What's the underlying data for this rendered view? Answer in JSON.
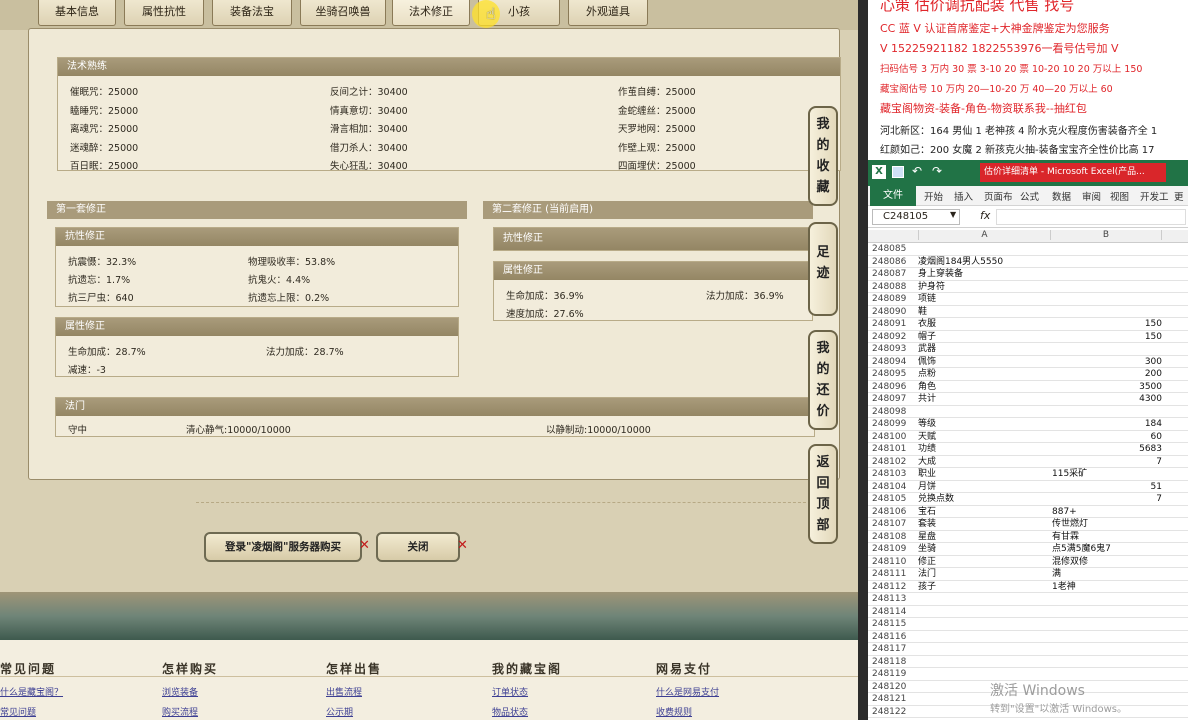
{
  "game": {
    "tabs": [
      "基本信息",
      "属性抗性",
      "装备法宝",
      "坐骑召唤兽",
      "法术修正",
      "小孩",
      "外观道具"
    ],
    "skill_section": {
      "title": "法术熟练",
      "rows": [
        [
          "催眠咒：25000",
          "反间之计：30400",
          "作茧自缚：25000"
        ],
        [
          "瞌睡咒：25000",
          "情真意切：30400",
          "金蛇缠丝：25000"
        ],
        [
          "离魂咒：25000",
          "滑言相加：30400",
          "天罗地网：25000"
        ],
        [
          "迷魂醉：25000",
          "借刀杀人：30400",
          "作壁上观：25000"
        ],
        [
          "百日眠：25000",
          "失心狂乱：30400",
          "四面埋伏：25000"
        ]
      ]
    },
    "set1": {
      "title": "第一套修正",
      "resist": {
        "title": "抗性修正",
        "items": [
          "抗震慑：32.3%",
          "物理吸收率：53.8%",
          "抗遗忘：1.7%",
          "抗鬼火：4.4%",
          "抗三尸虫：640",
          "抗遗忘上限：0.2%"
        ]
      },
      "attr": {
        "title": "属性修正",
        "items": [
          "生命加成：28.7%",
          "法力加成：28.7%",
          "减速：-3"
        ]
      }
    },
    "set2": {
      "title": "第二套修正 (当前启用)",
      "resist": {
        "title": "抗性修正"
      },
      "attr": {
        "title": "属性修正",
        "items": [
          "生命加成：36.9%",
          "法力加成：36.9%",
          "速度加成：27.6%"
        ]
      }
    },
    "magic": {
      "title": "法门",
      "items": [
        "守中",
        "清心静气:10000/10000",
        "以静制动:10000/10000"
      ]
    },
    "buttons": {
      "buy": "登录\"凌烟阁\"服务器购买",
      "close": "关闭"
    },
    "side": [
      "我的收藏",
      "足迹",
      "我的还价",
      "返回顶部"
    ],
    "footer": {
      "cols": [
        {
          "title": "常见问题",
          "links": [
            "什么是藏宝阁？",
            "常见问题"
          ]
        },
        {
          "title": "怎样购买",
          "links": [
            "浏览装备",
            "购买流程"
          ]
        },
        {
          "title": "怎样出售",
          "links": [
            "出售流程",
            "公示期"
          ]
        },
        {
          "title": "我的藏宝阁",
          "links": [
            "订单状态",
            "物品状态"
          ]
        },
        {
          "title": "网易支付",
          "links": [
            "什么是网易支付",
            "收费规则"
          ]
        }
      ]
    }
  },
  "notes": {
    "lines": [
      "心策 估价调抗配装 代售 找号",
      "CC 蓝 V 认证首席鉴定+大神金牌鉴定为您服务",
      "V 15225921182      1822553976一看号估号加 V",
      "扫码估号 3 万内 30 票 3-10 20 票 10-20 10 20 万以上 150",
      "藏宝阁估号 10 万内 20—10-20 万 40—20 万以上 60",
      "藏宝阁物资-装备-角色-物资联系我--抽红包",
      "河北新区：164 男仙 1 老神孩 4 阶水克火程度伤害装备齐全 1",
      "红颜如己：200 女魔 2 新孩克火抽-装备宝宝齐全性价比高 17"
    ]
  },
  "excel": {
    "title": "估价详细清单 - Microsoft Excel(产品...",
    "ribbon": [
      "文件",
      "开始",
      "插入",
      "页面布",
      "公式",
      "数据",
      "审阅",
      "视图",
      "开发工",
      "更"
    ],
    "namebox": "C248105",
    "fx": "fx",
    "cols": [
      "A",
      "B"
    ],
    "rows": [
      [
        "248085",
        "",
        ""
      ],
      [
        "248086",
        "凌烟阁184男人5550",
        ""
      ],
      [
        "248087",
        "身上穿装备",
        ""
      ],
      [
        "248088",
        "护身符",
        ""
      ],
      [
        "248089",
        "项链",
        ""
      ],
      [
        "248090",
        "鞋",
        ""
      ],
      [
        "248091",
        "衣服",
        "150"
      ],
      [
        "248092",
        "帽子",
        "150"
      ],
      [
        "248093",
        "武器",
        ""
      ],
      [
        "248094",
        "佩饰",
        "300"
      ],
      [
        "248095",
        "点粉",
        "200"
      ],
      [
        "248096",
        "角色",
        "3500"
      ],
      [
        "248097",
        "共计",
        "4300"
      ],
      [
        "248098",
        "",
        ""
      ],
      [
        "248099",
        "等级",
        "184"
      ],
      [
        "248100",
        "天赋",
        "60"
      ],
      [
        "248101",
        "功绩",
        "5683"
      ],
      [
        "248102",
        "大成",
        "7"
      ],
      [
        "248103",
        "职业",
        "115采矿"
      ],
      [
        "248104",
        "月饼",
        "51"
      ],
      [
        "248105",
        "兑换点数",
        "7"
      ],
      [
        "248106",
        "宝石",
        "887+"
      ],
      [
        "248107",
        "套装",
        "传世燃灯"
      ],
      [
        "248108",
        "星盘",
        "有甘霖"
      ],
      [
        "248109",
        "坐骑",
        "点5满5魔6鬼7"
      ],
      [
        "248110",
        "修正",
        "混修双修"
      ],
      [
        "248111",
        "法门",
        "满"
      ],
      [
        "248112",
        "孩子",
        "1老神"
      ],
      [
        "248113",
        "",
        ""
      ],
      [
        "248114",
        "",
        ""
      ],
      [
        "248115",
        "",
        ""
      ],
      [
        "248116",
        "",
        ""
      ],
      [
        "248117",
        "",
        ""
      ],
      [
        "248118",
        "",
        ""
      ],
      [
        "248119",
        "",
        ""
      ],
      [
        "248120",
        "",
        ""
      ],
      [
        "248121",
        "",
        ""
      ],
      [
        "248122",
        "",
        ""
      ]
    ],
    "right_aligned": [
      6,
      7,
      9,
      10,
      11,
      12,
      14,
      15,
      16,
      17,
      19,
      20
    ]
  },
  "watermark": {
    "line1": "激活 Windows",
    "line2": "转到\"设置\"以激活 Windows。"
  }
}
